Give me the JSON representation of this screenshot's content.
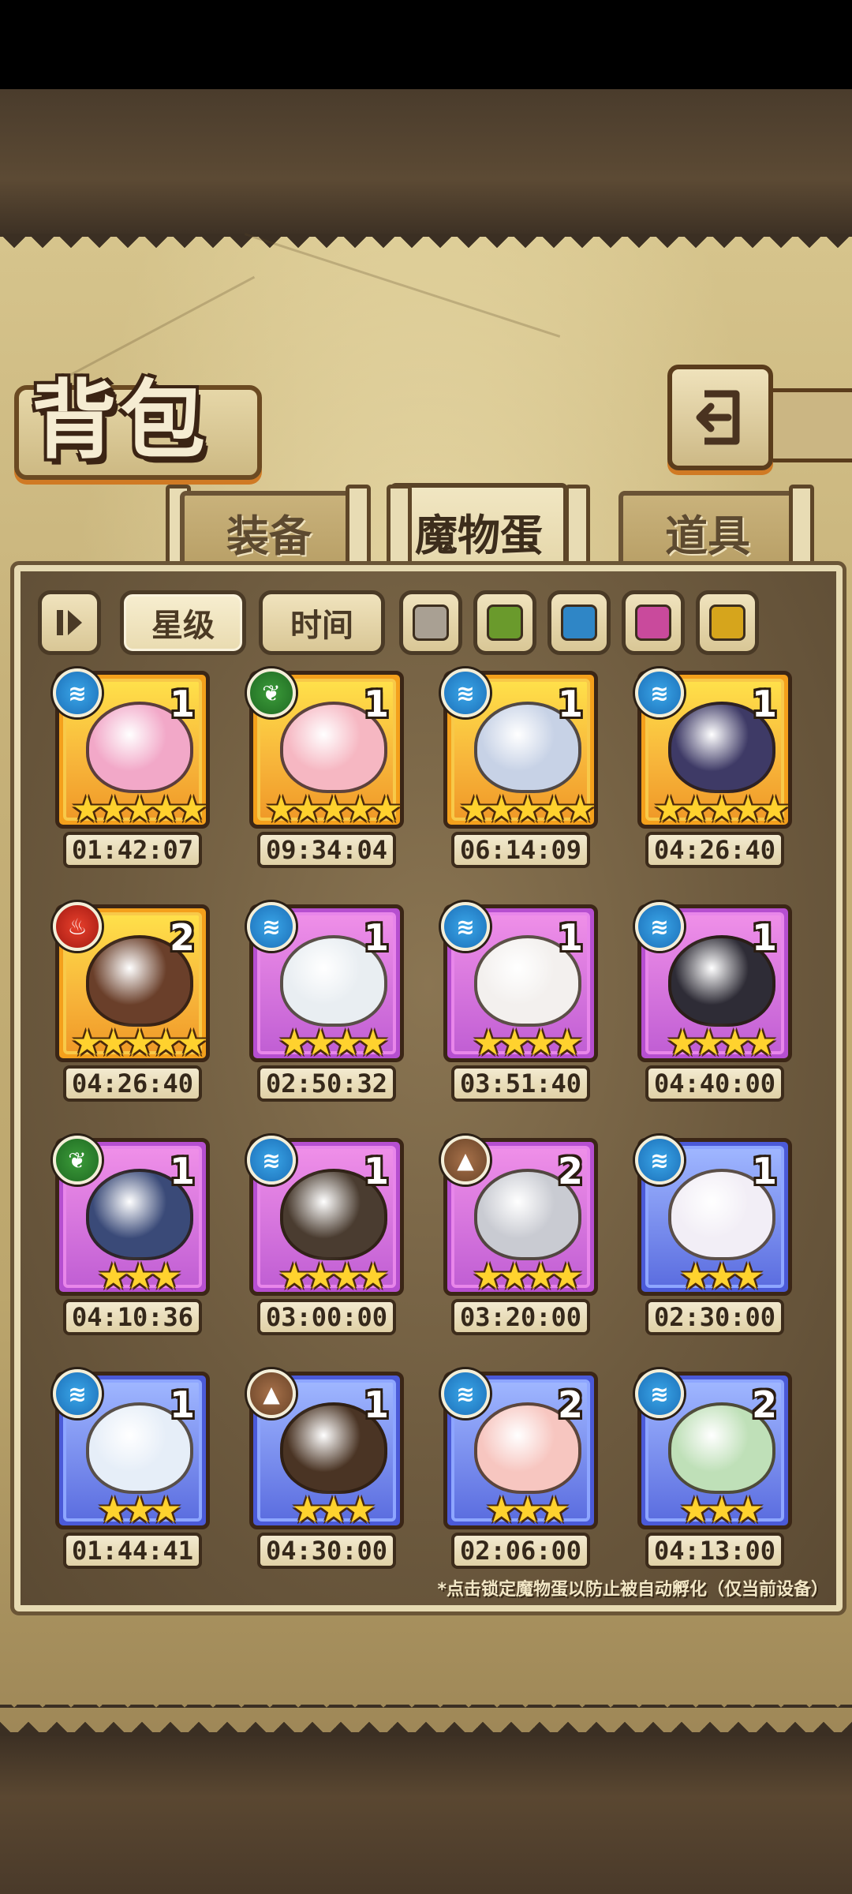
{
  "title": "背包",
  "tabs": [
    {
      "label": "装备",
      "active": false
    },
    {
      "label": "魔物蛋",
      "active": true
    },
    {
      "label": "道具",
      "active": false
    }
  ],
  "filters": {
    "sort_star": "星级",
    "sort_time": "时间",
    "colors": [
      "#a9a093",
      "#6a9a2c",
      "#2f86c6",
      "#c94a9c",
      "#d6a51c"
    ]
  },
  "items": [
    {
      "element": "water",
      "count": "1",
      "stars": "★★★★★",
      "timer": "01:42:07",
      "rarity": "gold",
      "art": "#f2a8c8"
    },
    {
      "element": "grass",
      "count": "1",
      "stars": "★★★★★",
      "timer": "09:34:04",
      "rarity": "gold",
      "art": "#f6b7c2"
    },
    {
      "element": "water",
      "count": "1",
      "stars": "★★★★★",
      "timer": "06:14:09",
      "rarity": "gold",
      "art": "#c7d2e6"
    },
    {
      "element": "water",
      "count": "1",
      "stars": "★★★★★",
      "timer": "04:26:40",
      "rarity": "gold",
      "art": "#3e3a66"
    },
    {
      "element": "fire",
      "count": "2",
      "stars": "★★★★★",
      "timer": "04:26:40",
      "rarity": "gold",
      "art": "#6a3f2a"
    },
    {
      "element": "water",
      "count": "1",
      "stars": "★★★★",
      "timer": "02:50:32",
      "rarity": "purple",
      "art": "#e9eef2"
    },
    {
      "element": "water",
      "count": "1",
      "stars": "★★★★",
      "timer": "03:51:40",
      "rarity": "purple",
      "art": "#f3f0ee"
    },
    {
      "element": "water",
      "count": "1",
      "stars": "★★★★",
      "timer": "04:40:00",
      "rarity": "purple",
      "art": "#2e2c36"
    },
    {
      "element": "grass",
      "count": "1",
      "stars": "★★★",
      "timer": "04:10:36",
      "rarity": "purple",
      "art": "#3a4a78"
    },
    {
      "element": "water",
      "count": "1",
      "stars": "★★★★",
      "timer": "03:00:00",
      "rarity": "purple",
      "art": "#4a3c30"
    },
    {
      "element": "earth",
      "count": "2",
      "stars": "★★★★",
      "timer": "03:20:00",
      "rarity": "purple",
      "art": "#c9cbd2"
    },
    {
      "element": "water",
      "count": "1",
      "stars": "★★★",
      "timer": "02:30:00",
      "rarity": "blue",
      "art": "#f2eef6"
    },
    {
      "element": "water",
      "count": "1",
      "stars": "★★★",
      "timer": "01:44:41",
      "rarity": "blue",
      "art": "#e6eef8"
    },
    {
      "element": "earth",
      "count": "1",
      "stars": "★★★",
      "timer": "04:30:00",
      "rarity": "blue",
      "art": "#4a3424"
    },
    {
      "element": "water",
      "count": "2",
      "stars": "★★★",
      "timer": "02:06:00",
      "rarity": "blue",
      "art": "#f7c6c0"
    },
    {
      "element": "water",
      "count": "2",
      "stars": "★★★",
      "timer": "04:13:00",
      "rarity": "blue",
      "art": "#bfe0b8"
    }
  ],
  "footnote": "*点击锁定魔物蛋以防止被自动孵化（仅当前设备）"
}
